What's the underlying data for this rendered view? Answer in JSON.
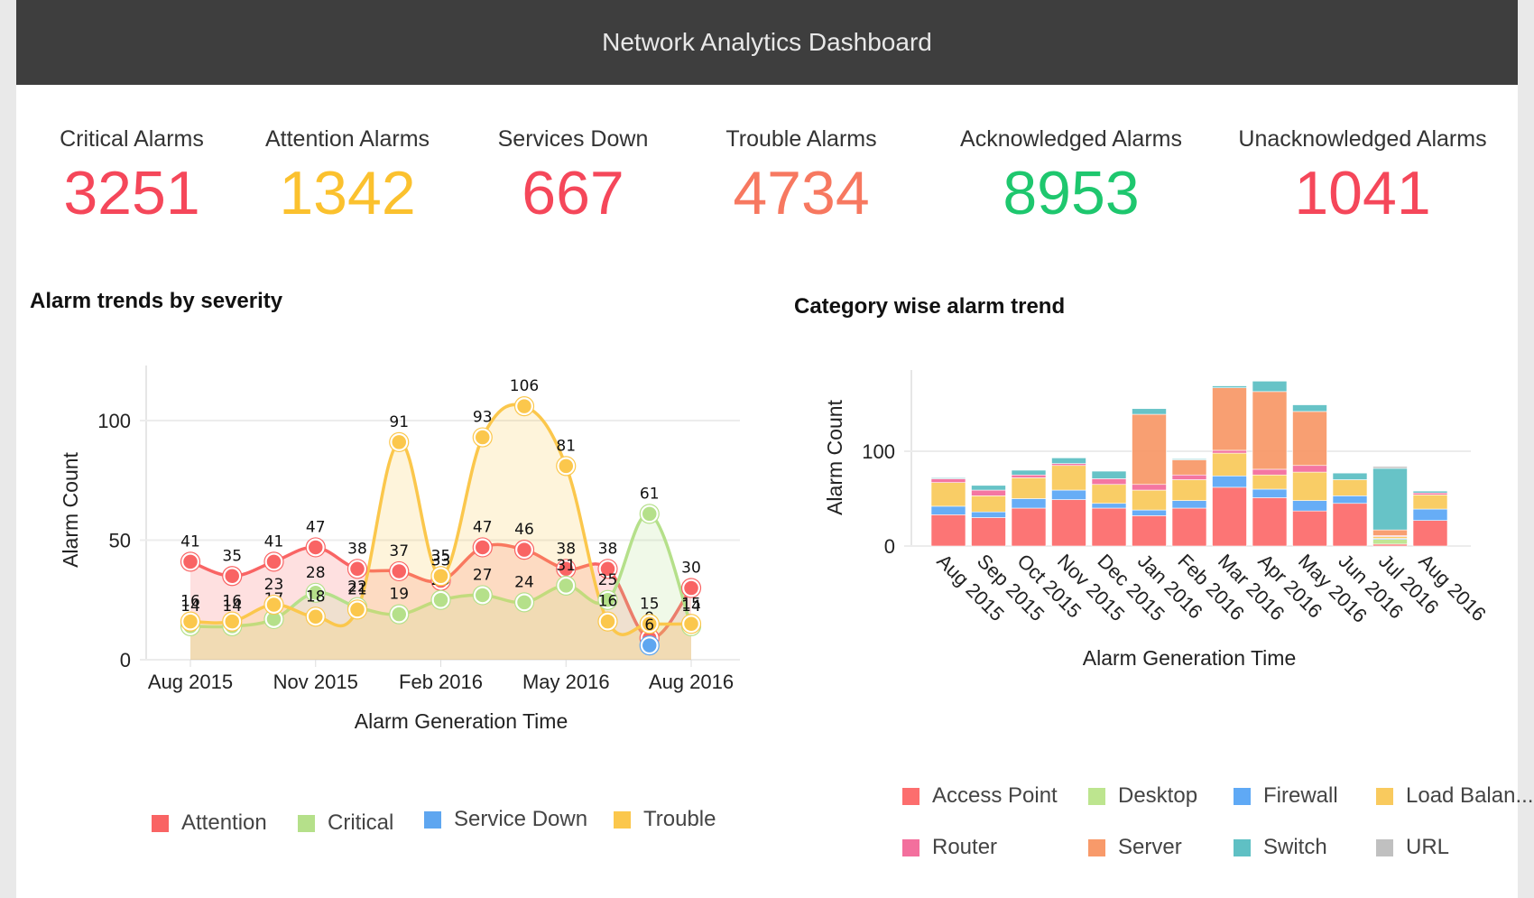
{
  "header": {
    "title": "Network Analytics Dashboard"
  },
  "kpis": [
    {
      "label": "Critical Alarms",
      "value": "3251",
      "color": "#f5475a"
    },
    {
      "label": "Attention Alarms",
      "value": "1342",
      "color": "#fbc12e"
    },
    {
      "label": "Services Down",
      "value": "667",
      "color": "#f5475a"
    },
    {
      "label": "Trouble Alarms",
      "value": "4734",
      "color": "#f77860"
    },
    {
      "label": "Acknowledged Alarms",
      "value": "8953",
      "color": "#1ec76e"
    },
    {
      "label": "Unacknowledged Alarms",
      "value": "1041",
      "color": "#f5475a"
    }
  ],
  "chart_data": [
    {
      "type": "area",
      "title": "Alarm trends by severity",
      "xlabel": "Alarm Generation Time",
      "ylabel": "Alarm Count",
      "ylim": [
        0,
        120
      ],
      "yticks": [
        0,
        50,
        100
      ],
      "grid": true,
      "legend": "bottom",
      "x": [
        "Aug 2015",
        "Sep 2015",
        "Oct 2015",
        "Nov 2015",
        "Dec 2015",
        "Jan 2016",
        "Feb 2016",
        "Mar 2016",
        "Apr 2016",
        "May 2016",
        "Jun 2016",
        "Jul 2016",
        "Aug 2016"
      ],
      "xtick_labels": [
        "Aug 2015",
        "Nov 2015",
        "Feb 2016",
        "May 2016",
        "Aug 2016"
      ],
      "series": [
        {
          "name": "Attention",
          "color": "#f96464",
          "values": [
            41,
            35,
            41,
            47,
            38,
            37,
            33,
            47,
            46,
            38,
            38,
            9,
            30
          ]
        },
        {
          "name": "Critical",
          "color": "#b5e08a",
          "values": [
            14,
            14,
            17,
            28,
            22,
            19,
            25,
            27,
            24,
            31,
            25,
            61,
            14
          ]
        },
        {
          "name": "Service Down",
          "color": "#5ea6f0",
          "values": [
            null,
            null,
            null,
            null,
            null,
            null,
            null,
            null,
            null,
            null,
            null,
            6,
            null
          ]
        },
        {
          "name": "Trouble",
          "color": "#fbc74c",
          "values": [
            16,
            16,
            23,
            18,
            21,
            91,
            35,
            93,
            106,
            81,
            16,
            15,
            15
          ]
        }
      ]
    },
    {
      "type": "bar",
      "stacked": true,
      "title": "Category wise alarm trend",
      "xlabel": "Alarm Generation Time",
      "ylabel": "Alarm Count",
      "ylim": [
        0,
        185
      ],
      "yticks": [
        0,
        100
      ],
      "grid": true,
      "legend": "bottom",
      "categories": [
        "Aug 2015",
        "Sep 2015",
        "Oct 2015",
        "Nov 2015",
        "Dec 2015",
        "Jan 2016",
        "Feb 2016",
        "Mar 2016",
        "Apr 2016",
        "May 2016",
        "Jun 2016",
        "Jul 2016",
        "Aug 2016"
      ],
      "series": [
        {
          "name": "Access Point",
          "color": "#fc6e6e",
          "values": [
            33,
            30,
            40,
            49,
            40,
            32,
            40,
            62,
            51,
            37,
            45,
            2,
            27
          ]
        },
        {
          "name": "Desktop",
          "color": "#bde58f",
          "values": [
            0,
            0,
            0,
            0,
            0,
            0,
            0,
            0,
            0,
            0,
            0,
            5,
            0
          ]
        },
        {
          "name": "Firewall",
          "color": "#5fa9f5",
          "values": [
            9,
            6,
            10,
            10,
            5,
            6,
            8,
            12,
            9,
            11,
            8,
            1,
            12
          ]
        },
        {
          "name": "Load Balan...",
          "color": "#f9ca5e",
          "values": [
            25,
            17,
            22,
            26,
            20,
            21,
            22,
            24,
            15,
            30,
            17,
            2,
            15
          ]
        },
        {
          "name": "Router",
          "color": "#f36f9d",
          "values": [
            4,
            6,
            3,
            2,
            6,
            6,
            5,
            3,
            6,
            7,
            0,
            1,
            2
          ]
        },
        {
          "name": "Server",
          "color": "#f89a6a",
          "values": [
            0,
            0,
            0,
            0,
            0,
            74,
            16,
            66,
            82,
            57,
            0,
            6,
            0
          ]
        },
        {
          "name": "Switch",
          "color": "#5fc0c4",
          "values": [
            1,
            5,
            5,
            6,
            8,
            6,
            1,
            2,
            11,
            7,
            7,
            65,
            2
          ]
        },
        {
          "name": "URL",
          "color": "#c0c0c0",
          "values": [
            0,
            0,
            0,
            0,
            0,
            0,
            0,
            0,
            0,
            0,
            0,
            2,
            0
          ]
        }
      ]
    }
  ]
}
